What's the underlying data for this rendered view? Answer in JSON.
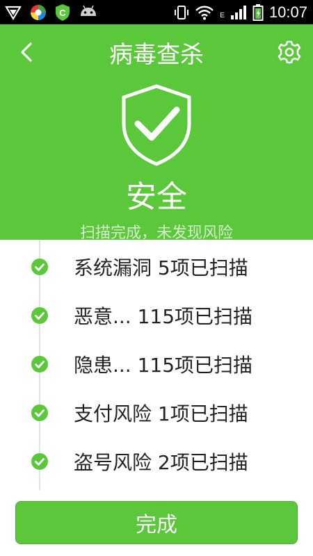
{
  "status_bar": {
    "time": "10:07",
    "network_type": "E"
  },
  "header": {
    "title": "病毒查杀",
    "status": "安全",
    "summary": "扫描完成，未发现风险"
  },
  "results": [
    {
      "label": "系统漏洞 5项已扫描"
    },
    {
      "label": "恶意... 115项已扫描"
    },
    {
      "label": "隐患... 115项已扫描"
    },
    {
      "label": "支付风险 1项已扫描"
    },
    {
      "label": "盗号风险 2项已扫描"
    }
  ],
  "footer": {
    "done_label": "完成"
  },
  "colors": {
    "accent": "#5ac83a",
    "check": "#5ac83a"
  }
}
